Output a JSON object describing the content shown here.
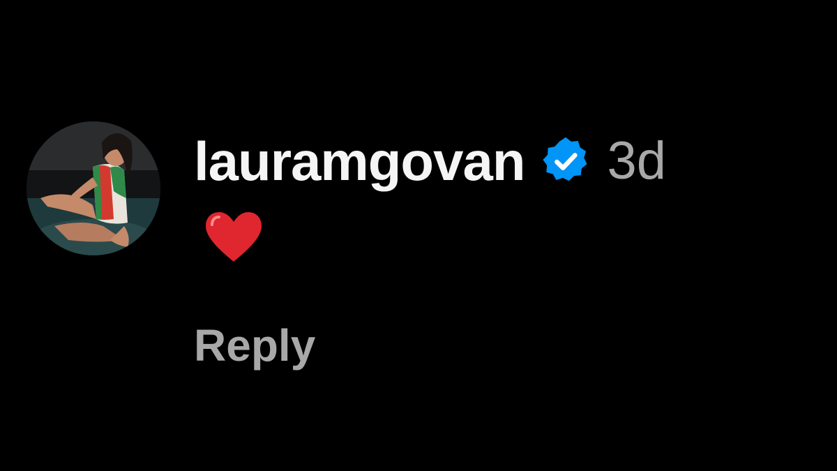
{
  "comment": {
    "username": "lauramgovan",
    "verified_icon": "verified-badge-icon",
    "timestamp": "3d",
    "body_emoji": "red-heart-icon",
    "reply_label": "Reply"
  },
  "colors": {
    "background": "#000000",
    "username": "#f5f5f5",
    "muted_text": "#a8a8a8",
    "verified_badge": "#0095f6",
    "heart": "#e0262f"
  }
}
